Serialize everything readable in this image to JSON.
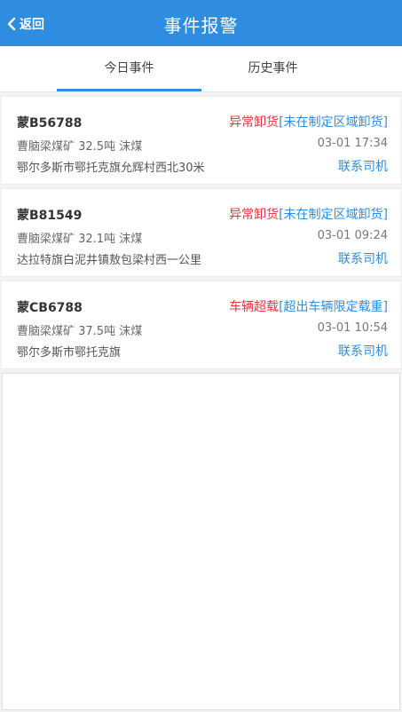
{
  "header": {
    "back_label": "返回",
    "title": "事件报警"
  },
  "tabs": [
    {
      "label": "今日事件",
      "active": true
    },
    {
      "label": "历史事件",
      "active": false
    }
  ],
  "colors": {
    "accent": "#2e8de0",
    "alert_red": "#e8343c"
  },
  "events": [
    {
      "plate": "蒙B56788",
      "alert_type": "异常卸货",
      "alert_detail": "[未在制定区域卸货]",
      "cargo": "曹脑梁煤矿 32.5吨 沫煤",
      "time": "03-01 17:34",
      "address": "鄂尔多斯市鄂托克旗允辉村西北30米",
      "contact_label": "联系司机"
    },
    {
      "plate": "蒙B81549",
      "alert_type": "异常卸货",
      "alert_detail": "[未在制定区域卸货]",
      "cargo": "曹脑梁煤矿 32.1吨 沫煤",
      "time": "03-01 09:24",
      "address": "达拉特旗白泥井镇敖包梁村西一公里",
      "contact_label": "联系司机"
    },
    {
      "plate": "蒙CB6788",
      "alert_type": "车辆超载",
      "alert_detail": "[超出车辆限定载重]",
      "cargo": "曹脑梁煤矿 37.5吨 沫煤",
      "time": "03-01 10:54",
      "address": "鄂尔多斯市鄂托克旗",
      "contact_label": "联系司机"
    }
  ]
}
